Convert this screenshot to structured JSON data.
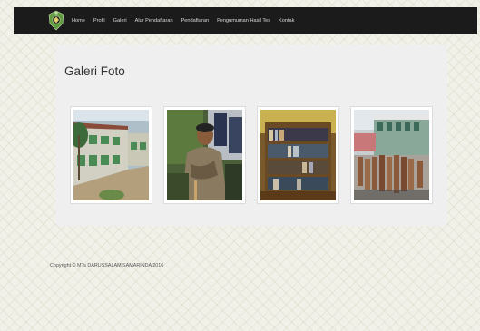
{
  "nav": {
    "logo_icon": "school-emblem-icon",
    "items": [
      {
        "label": "Home"
      },
      {
        "label": "Profil"
      },
      {
        "label": "Galeri"
      },
      {
        "label": "Alur Pendaftaran"
      },
      {
        "label": "Pendaftaran"
      },
      {
        "label": "Pengumuman Hasil Tes"
      },
      {
        "label": "Kontak"
      }
    ]
  },
  "gallery": {
    "title": "Galeri Foto",
    "photos": [
      {
        "icon": "school-building-photo"
      },
      {
        "icon": "students-outdoor-photo"
      },
      {
        "icon": "library-bookshelf-photo"
      },
      {
        "icon": "students-assembly-photo"
      }
    ]
  },
  "footer": {
    "copyright": "Copyright © MTs DARUSSALAM SAMARINDA 2016"
  },
  "colors": {
    "navbar": "#1b1b1b",
    "nav_text": "#d8d8d8",
    "panel": "#efefef",
    "background": "#f1f1ea",
    "logo": "#5e9a3e"
  }
}
